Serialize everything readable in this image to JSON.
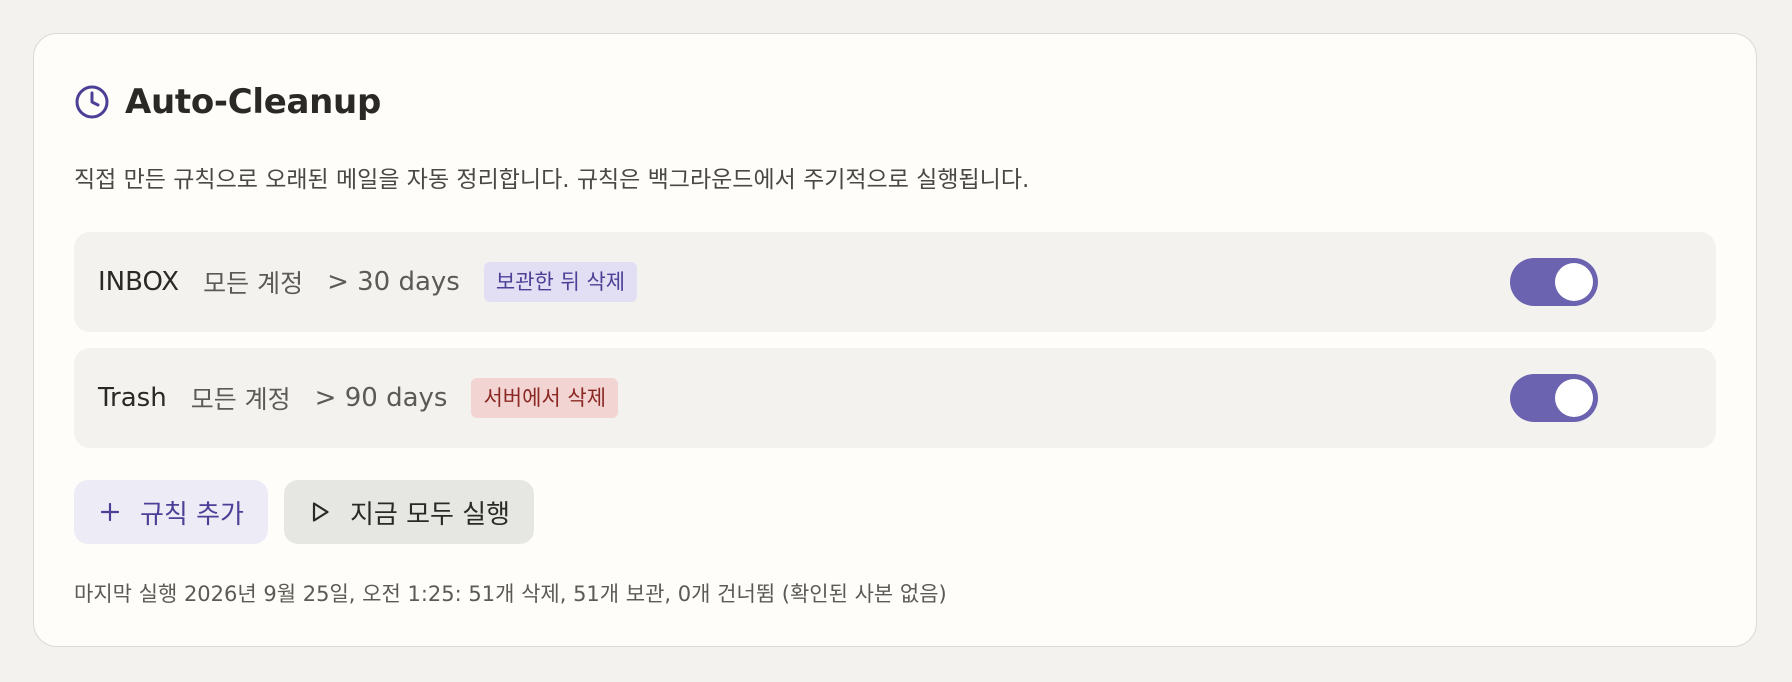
{
  "card": {
    "title": "Auto-Cleanup",
    "icon": "clock-icon",
    "description": "직접 만든 규칙으로 오래된 메일을 자동 정리합니다. 규칙은 백그라운드에서 주기적으로 실행됩니다."
  },
  "rules": [
    {
      "folder": "INBOX",
      "account": "모든 계정",
      "age": "> 30 days",
      "action": "보관한 뒤 삭제",
      "action_type": "archive",
      "enabled": true
    },
    {
      "folder": "Trash",
      "account": "모든 계정",
      "age": "> 90 days",
      "action": "서버에서 삭제",
      "action_type": "delete",
      "enabled": true
    }
  ],
  "buttons": {
    "add_rule": "규칙 추가",
    "add_rule_icon": "plus-icon",
    "run_all": "지금 모두 실행",
    "run_all_icon": "play-icon"
  },
  "status": "마지막 실행 2026년 9월 25일, 오전 1:25: 51개 삭제, 51개 보관, 0개 건너뜀 (확인된 사본 없음)",
  "colors": {
    "accent": "#6c63b0",
    "archive_badge_bg": "#e2dff4",
    "archive_badge_text": "#4b3f96",
    "delete_badge_bg": "#f2d4d2",
    "delete_badge_text": "#8b2823",
    "card_bg": "#fefdf9",
    "page_bg": "#f3f2ef"
  }
}
